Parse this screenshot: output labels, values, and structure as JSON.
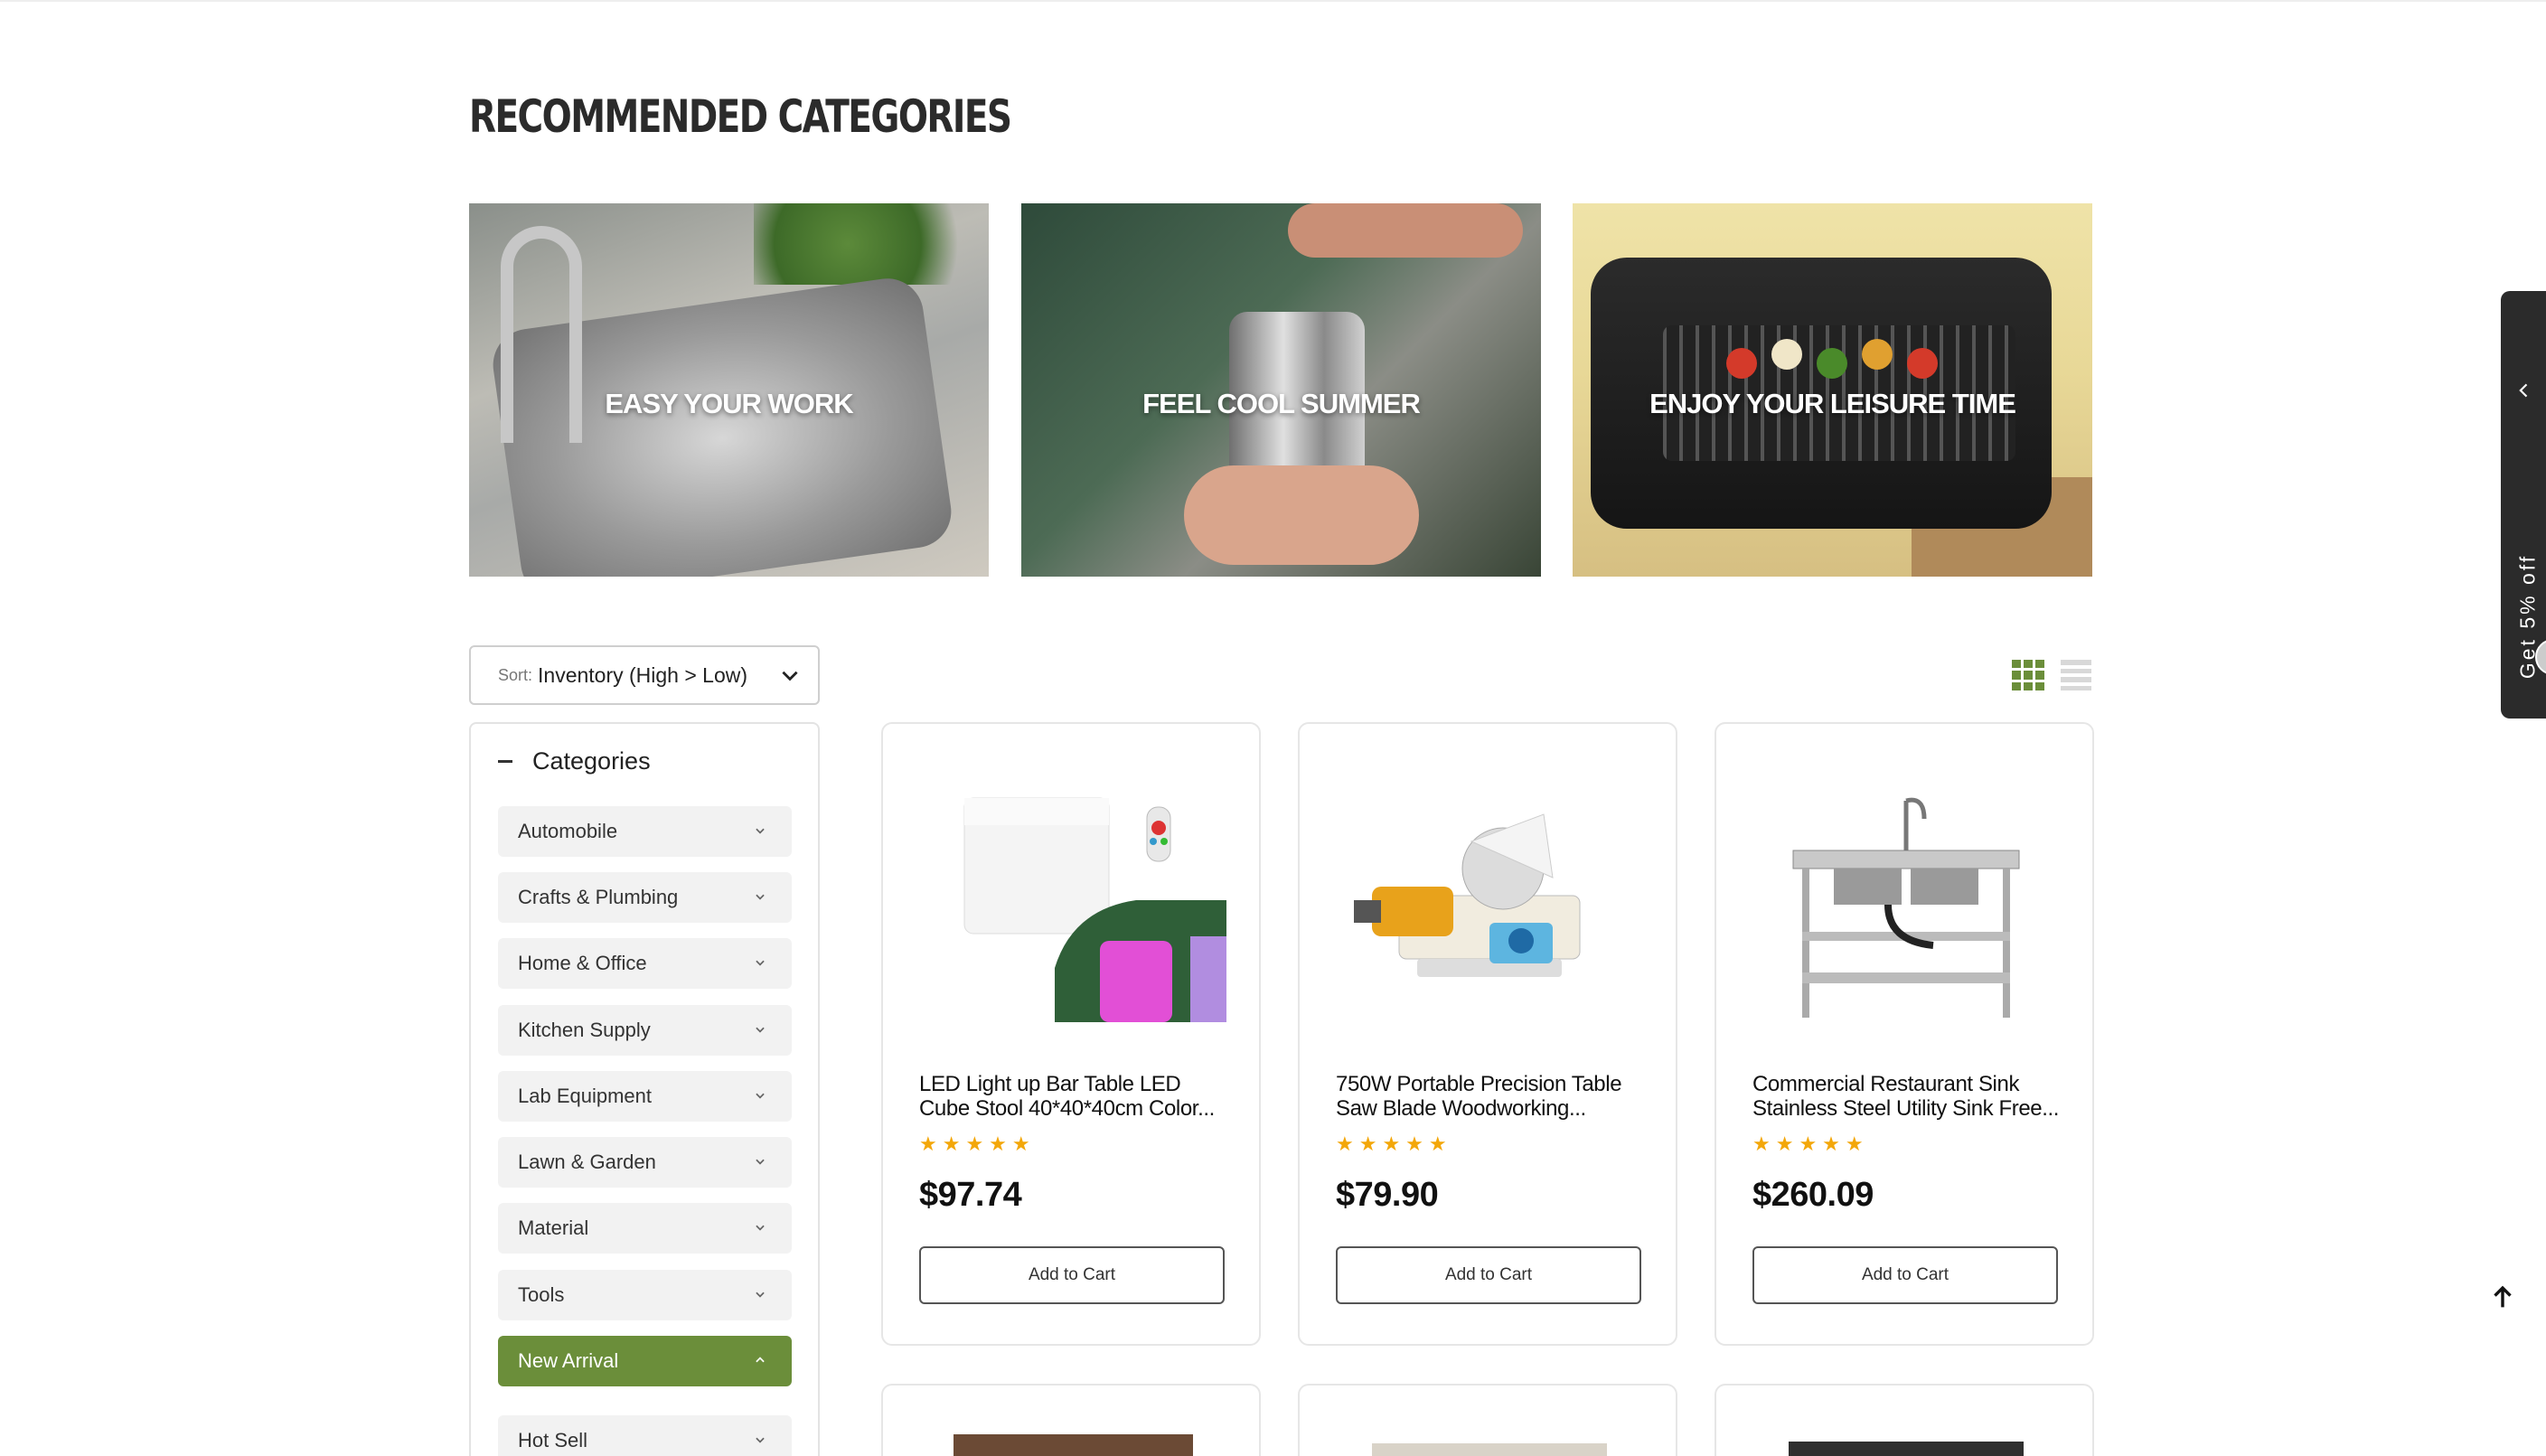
{
  "section_title": "RECOMMENDED CATEGORIES",
  "banners": [
    {
      "label": "EASY YOUR WORK"
    },
    {
      "label": "FEEL COOL SUMMER"
    },
    {
      "label": "ENJOY YOUR LEISURE TIME"
    }
  ],
  "sort": {
    "prefix": "Sort:",
    "value": "Inventory (High > Low)"
  },
  "view": {
    "active": "grid"
  },
  "sidebar": {
    "heading": "Categories",
    "items": [
      {
        "label": "Automobile",
        "expanded": false
      },
      {
        "label": "Crafts & Plumbing",
        "expanded": false
      },
      {
        "label": "Home & Office",
        "expanded": false
      },
      {
        "label": "Kitchen Supply",
        "expanded": false
      },
      {
        "label": "Lab Equipment",
        "expanded": false
      },
      {
        "label": "Lawn & Garden",
        "expanded": false
      },
      {
        "label": "Material",
        "expanded": false
      },
      {
        "label": "Tools",
        "expanded": false
      },
      {
        "label": "New Arrival",
        "expanded": true
      },
      {
        "label": "Hot Sell",
        "expanded": false
      }
    ]
  },
  "products": [
    {
      "title": "LED Light up Bar Table LED Cube Stool 40*40*40cm Color...",
      "rating": 5,
      "stars": "★★★★★",
      "price": "$97.74",
      "button": "Add to Cart"
    },
    {
      "title": "750W Portable Precision Table Saw Blade Woodworking...",
      "rating": 5,
      "stars": "★★★★★",
      "price": "$79.90",
      "button": "Add to Cart"
    },
    {
      "title": "Commercial Restaurant Sink Stainless Steel Utility Sink Free...",
      "rating": 5,
      "stars": "★★★★★",
      "price": "$260.09",
      "button": "Add to Cart"
    }
  ],
  "promo": {
    "text": "Get 5% off"
  },
  "colors": {
    "accent": "#6b8e3a",
    "star": "#f3a70a",
    "promo_bg": "#2b2b2b"
  }
}
